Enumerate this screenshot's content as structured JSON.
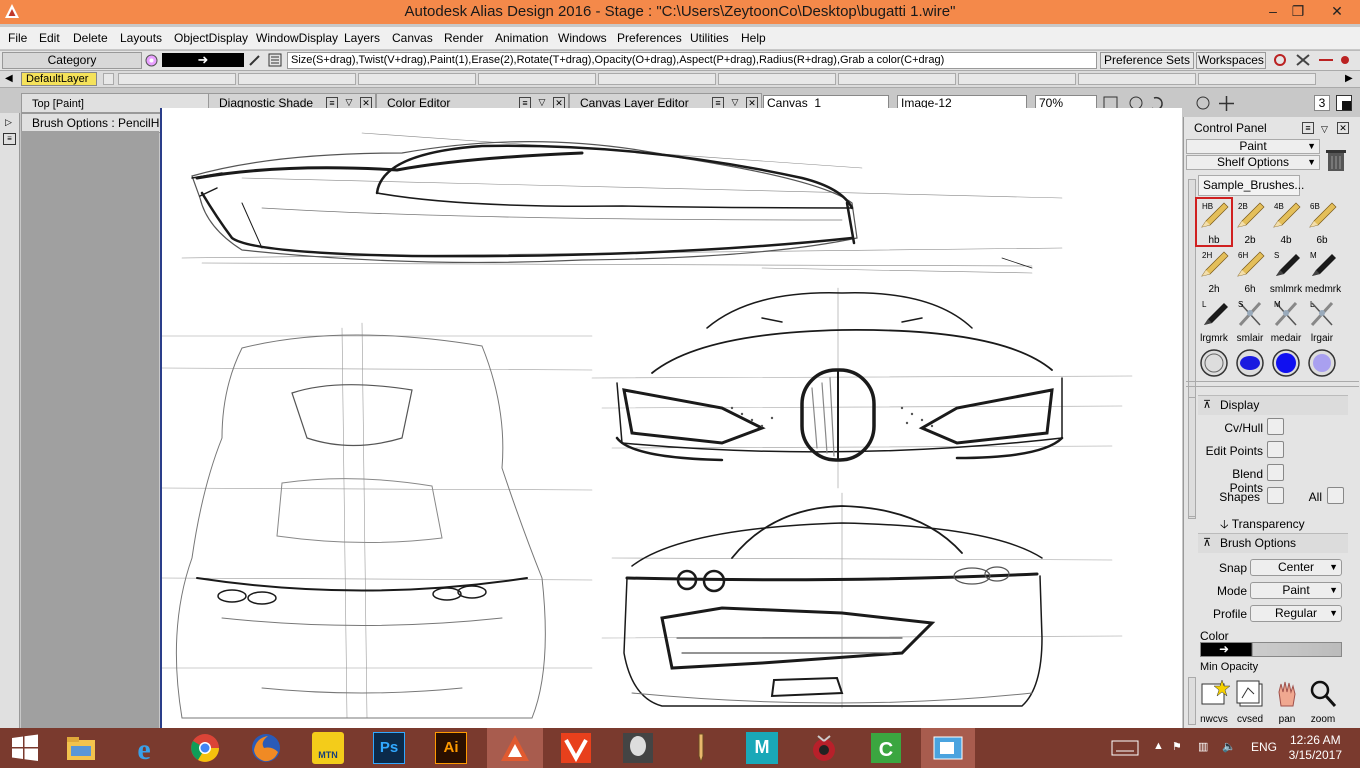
{
  "window": {
    "title": "Autodesk Alias Design 2016     - Stage : \"C:\\Users\\ZeytoonCo\\Desktop\\bugatti 1.wire\""
  },
  "menu": [
    "File",
    "Edit",
    "Delete",
    "Layouts",
    "ObjectDisplay",
    "WindowDisplay",
    "Layers",
    "Canvas",
    "Render",
    "Animation",
    "Windows",
    "Preferences",
    "Utilities",
    "Help"
  ],
  "toolbar": {
    "category": "Category",
    "hint": "Size(S+drag),Twist(V+drag),Paint(1),Erase(2),Rotate(T+drag),Opacity(O+drag),Aspect(P+drag),Radius(R+drag),Grab a color(C+drag)",
    "preference_sets": "Preference Sets",
    "workspaces": "Workspaces"
  },
  "layers": {
    "default_layer": "DefaultLayer"
  },
  "windows": {
    "top_paint": "Top [Paint]",
    "diagnostic_shade": "Diagnostic Shade",
    "color_editor": "Color Editor",
    "canvas_layer_editor": "Canvas Layer Editor",
    "canvas_name": "Canvas_1",
    "image_name": "Image-12",
    "zoom": "70%",
    "counter": "3"
  },
  "brush_options_title": "Brush Options : PencilHB",
  "control_panel": {
    "title": "Control Panel",
    "mode": "Paint",
    "shelf_options": "Shelf Options",
    "shelf_tab": "Sample_Brushes...",
    "brushes": [
      {
        "label": "hb",
        "tag": "HB"
      },
      {
        "label": "2b",
        "tag": "2B"
      },
      {
        "label": "4b",
        "tag": "4B"
      },
      {
        "label": "6b",
        "tag": "6B"
      },
      {
        "label": "2h",
        "tag": "2H"
      },
      {
        "label": "6h",
        "tag": "6H"
      },
      {
        "label": "smlmrk",
        "tag": "S"
      },
      {
        "label": "medmrk",
        "tag": "M"
      },
      {
        "label": "lrgmrk",
        "tag": "L"
      },
      {
        "label": "smlair",
        "tag": "S"
      },
      {
        "label": "medair",
        "tag": "M"
      },
      {
        "label": "lrgair",
        "tag": "L"
      }
    ],
    "display": {
      "heading": "Display",
      "cv_hull": "Cv/Hull",
      "edit_points": "Edit Points",
      "blend_points": "Blend Points",
      "shapes": "Shapes",
      "all": "All",
      "transparency": "Transparency"
    },
    "brush_options": {
      "heading": "Brush Options",
      "snap_label": "Snap",
      "snap_value": "Center",
      "mode_label": "Mode",
      "mode_value": "Paint",
      "profile_label": "Profile",
      "profile_value": "Regular",
      "color_label": "Color",
      "min_opacity": "Min Opacity"
    },
    "tools": [
      "nwcvs",
      "cvsed",
      "pan",
      "zoom"
    ]
  },
  "taskbar": {
    "language": "ENG",
    "time": "12:26 AM",
    "date": "3/15/2017",
    "mtn_label": "MTN"
  },
  "colors": {
    "titlebar": "#f4894a",
    "taskbar": "#7a3a2e",
    "default_layer": "#f5e25a",
    "selection": "#d02020"
  }
}
